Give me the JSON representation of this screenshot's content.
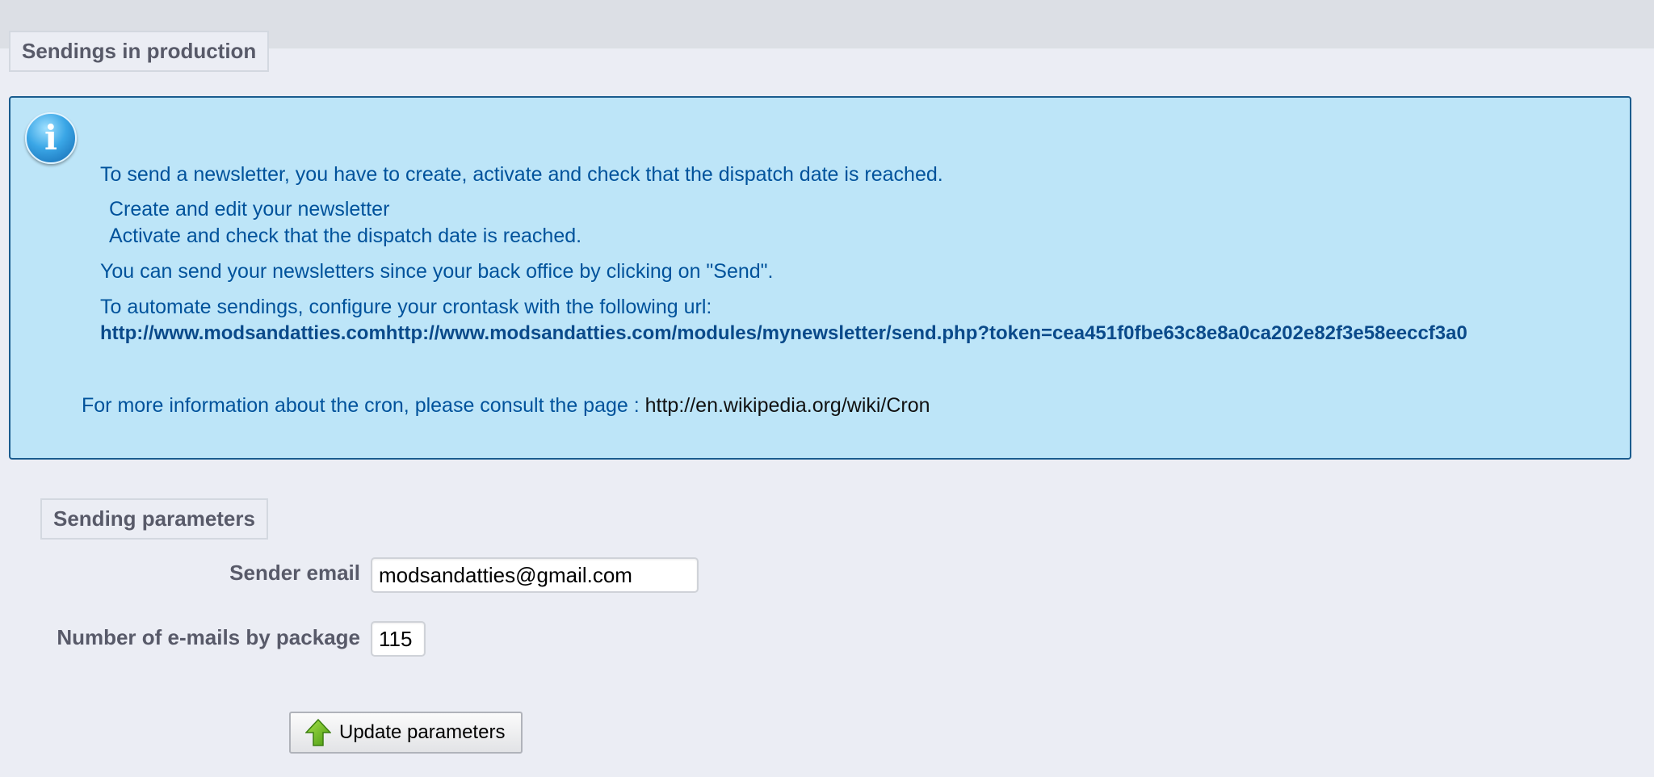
{
  "sections": {
    "production_title": "Sendings in production",
    "parameters_title": "Sending parameters"
  },
  "info": {
    "icon": "info-icon",
    "icon_glyph": "i",
    "line1": "To send a newsletter, you have to create, activate and check that the dispatch date is reached.",
    "step1": "Create and edit your newsletter",
    "step2": "Activate and check that the dispatch date is reached.",
    "line2": "You can send your newsletters since your back office by clicking on \"Send\".",
    "line3": "To automate sendings, configure your crontask with the following url:",
    "cron_url": "http://www.modsandatties.comhttp://www.modsandatties.com/modules/mynewsletter/send.php?token=cea451f0fbe63c8e8a0ca202e82f3e58eeccf3a0",
    "more_info_text": "For more information about the cron, please consult the page : ",
    "more_info_link": "http://en.wikipedia.org/wiki/Cron"
  },
  "form": {
    "sender_email_label": "Sender email",
    "sender_email_value": "modsandatties@gmail.com",
    "emails_per_package_label": "Number of e-mails by package",
    "emails_per_package_value": "115",
    "update_button_label": "Update parameters",
    "update_button_icon": "green-up-arrow-icon"
  },
  "colors": {
    "info_background": "#bde5f8",
    "info_border": "#1a5c8e",
    "info_text": "#00529b",
    "page_background": "#ebedf4",
    "label_text": "#585a69"
  }
}
